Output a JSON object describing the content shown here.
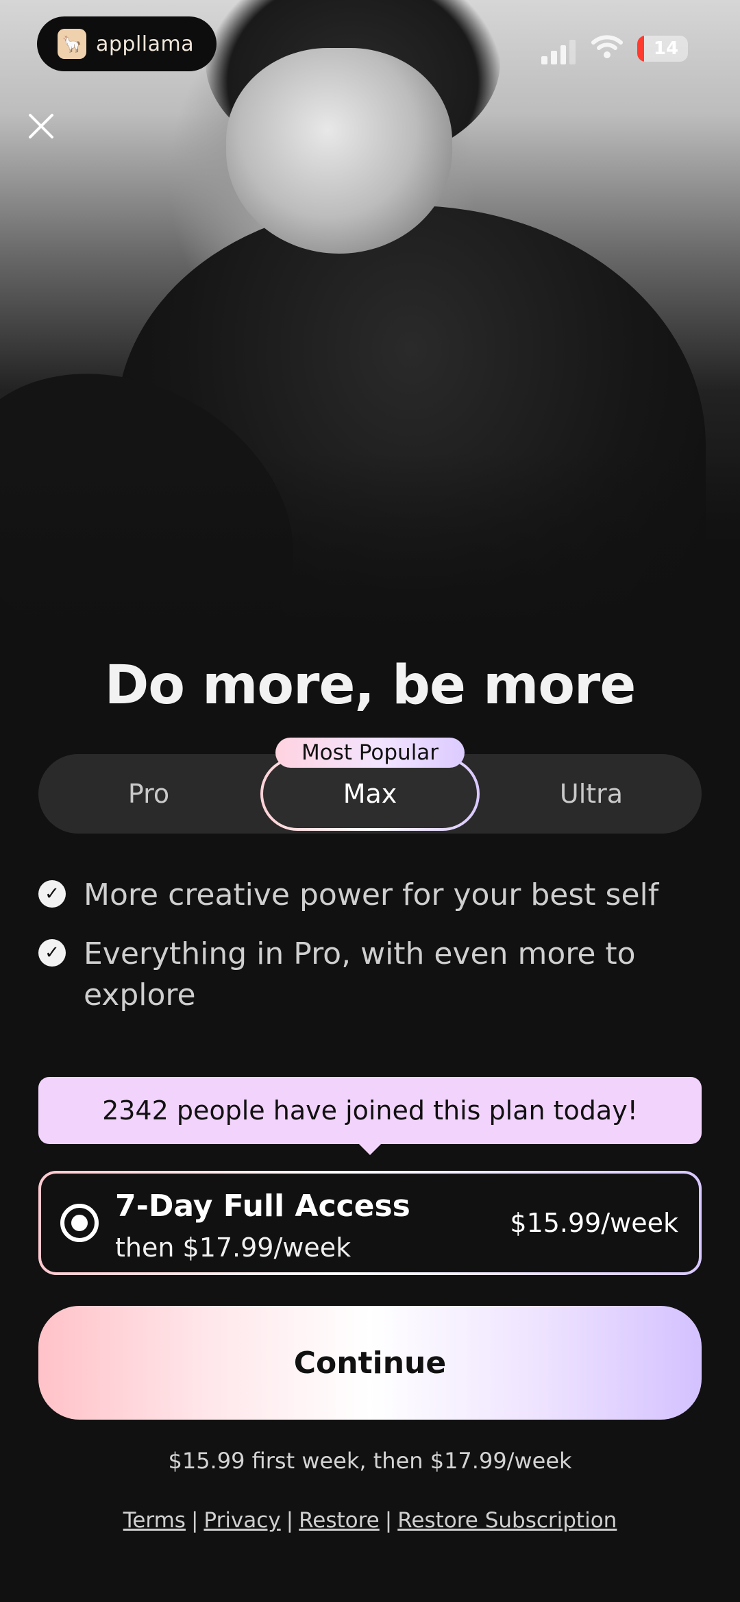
{
  "badge": {
    "name": "appllama"
  },
  "status": {
    "battery": "14"
  },
  "headline": "Do more, be more",
  "tabs": {
    "pro": "Pro",
    "max": "Max",
    "ultra": "Ultra",
    "popular_label": "Most Popular",
    "selected": "Max"
  },
  "features": [
    "More creative power for your best self",
    "Everything in Pro, with even more to explore"
  ],
  "banner": "2342 people have joined this plan today!",
  "plan": {
    "title": "7-Day Full Access",
    "subtitle": "then $17.99/week",
    "price": "$15.99/week"
  },
  "cta": "Continue",
  "footnote": "$15.99 first week, then $17.99/week",
  "links": {
    "terms": "Terms",
    "privacy": "Privacy",
    "restore": "Restore",
    "restore_subscription": "Restore Subscription",
    "separator": "|"
  },
  "colors": {
    "background": "#111111",
    "banner": "#f2d3fb",
    "gradient_start": "#ffc2c8",
    "gradient_end": "#d3c1ff"
  }
}
